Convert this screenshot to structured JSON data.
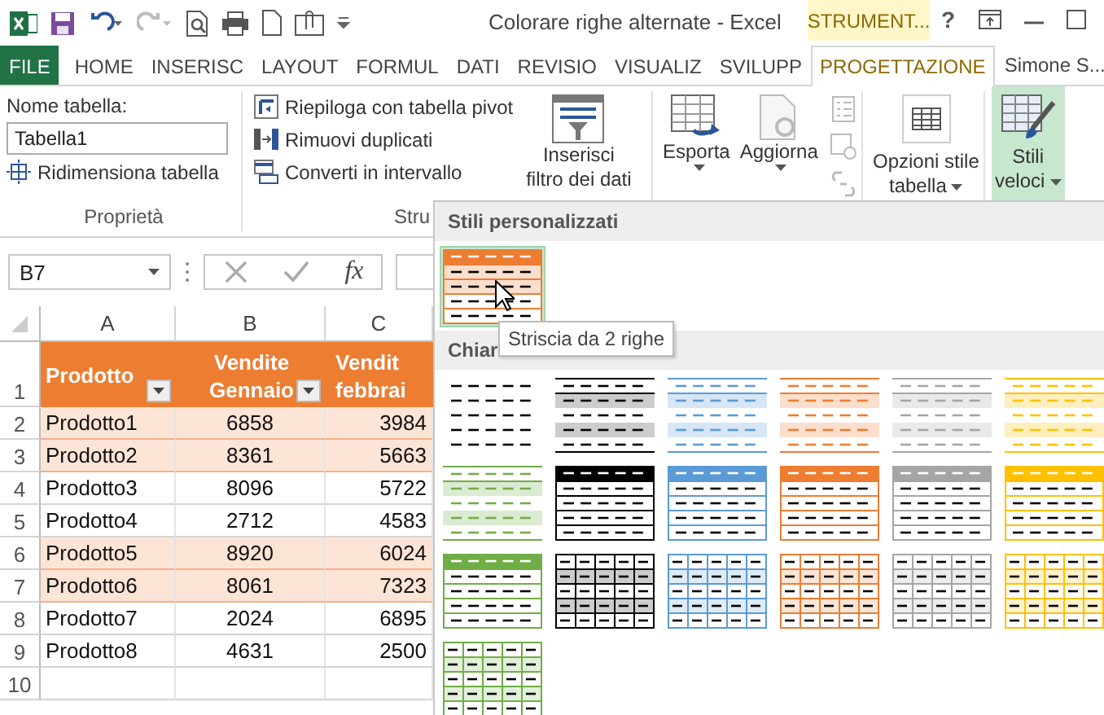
{
  "title_bar": {
    "title": "Colorare righe alternate - Excel",
    "context_label": "STRUMENT...",
    "help": "?"
  },
  "ribbon_tabs": [
    {
      "label": "FILE",
      "kind": "file",
      "selected": false
    },
    {
      "label": "HOME",
      "kind": "tab",
      "selected": false
    },
    {
      "label": "INSERISC",
      "kind": "tab",
      "selected": false
    },
    {
      "label": "LAYOUT",
      "kind": "tab",
      "selected": false
    },
    {
      "label": "FORMUL",
      "kind": "tab",
      "selected": false
    },
    {
      "label": "DATI",
      "kind": "tab",
      "selected": false
    },
    {
      "label": "REVISIO",
      "kind": "tab",
      "selected": false
    },
    {
      "label": "VISUALIZ",
      "kind": "tab",
      "selected": false
    },
    {
      "label": "SVILUPP",
      "kind": "tab",
      "selected": false
    },
    {
      "label": "PROGETTAZIONE",
      "kind": "context",
      "selected": true
    }
  ],
  "account": {
    "name": "Simone S..."
  },
  "ribbon": {
    "properties": {
      "name_label": "Nome tabella:",
      "name_value": "Tabella1",
      "resize": "Ridimensiona tabella",
      "group_label": "Proprietà"
    },
    "tools": {
      "commands": [
        "Riepiloga con tabella pivot",
        "Rimuovi duplicati",
        "Converti in intervallo"
      ],
      "slicer": [
        "Inserisci",
        "filtro dei dati"
      ],
      "group_label": "Stru"
    },
    "external": {
      "export": "Esporta",
      "refresh": "Aggiorna"
    },
    "style_options": {
      "lines": [
        "Opzioni stile",
        "tabella"
      ]
    },
    "quick_styles": {
      "lines": [
        "Stili",
        "veloci"
      ],
      "pressed": true
    }
  },
  "formula_bar": {
    "name_box": "B7",
    "function_label": "fx"
  },
  "sheet": {
    "columns": [
      "A",
      "B",
      "C"
    ],
    "header_row": {
      "number": "1",
      "cells": [
        {
          "lines": [
            "Prodotto"
          ],
          "filter": true
        },
        {
          "lines": [
            "Vendite",
            "Gennaio"
          ],
          "filter": true
        },
        {
          "lines": [
            "Vendit",
            "febbrai"
          ],
          "filter": false
        }
      ]
    },
    "rows": [
      {
        "number": "2",
        "banded": true,
        "cells": [
          "Prodotto1",
          "6858",
          "3984"
        ]
      },
      {
        "number": "3",
        "banded": true,
        "cells": [
          "Prodotto2",
          "8361",
          "5663"
        ]
      },
      {
        "number": "4",
        "banded": false,
        "cells": [
          "Prodotto3",
          "8096",
          "5722"
        ]
      },
      {
        "number": "5",
        "banded": false,
        "cells": [
          "Prodotto4",
          "2712",
          "4583"
        ]
      },
      {
        "number": "6",
        "banded": true,
        "cells": [
          "Prodotto5",
          "8920",
          "6024"
        ]
      },
      {
        "number": "7",
        "banded": true,
        "cells": [
          "Prodotto6",
          "8061",
          "7323"
        ]
      },
      {
        "number": "8",
        "banded": false,
        "cells": [
          "Prodotto7",
          "2024",
          "6895"
        ]
      },
      {
        "number": "9",
        "banded": false,
        "cells": [
          "Prodotto8",
          "4631",
          "2500"
        ]
      },
      {
        "number": "10",
        "banded": false,
        "cells": []
      }
    ]
  },
  "styles_gallery": {
    "sections": [
      {
        "title": "Stili personalizzati",
        "styles": [
          {
            "kind": "striped2",
            "color": "#ed7d31",
            "selected": true
          }
        ]
      },
      {
        "title": "Chiar",
        "styles": [
          {
            "kind": "plain",
            "color": "#000000",
            "selected": false
          },
          {
            "kind": "light",
            "color": "#000000",
            "selected": false
          },
          {
            "kind": "light",
            "color": "#5b9bd5",
            "selected": false
          },
          {
            "kind": "light",
            "color": "#ed7d31",
            "selected": false
          },
          {
            "kind": "light",
            "color": "#a5a5a5",
            "selected": false
          },
          {
            "kind": "light",
            "color": "#ffc000",
            "selected": false
          },
          {
            "kind": "light",
            "color": "#70ad47",
            "selected": false
          },
          {
            "kind": "medium",
            "color": "#000000",
            "selected": false
          },
          {
            "kind": "medium",
            "color": "#5b9bd5",
            "selected": false
          },
          {
            "kind": "medium",
            "color": "#ed7d31",
            "selected": false
          },
          {
            "kind": "medium",
            "color": "#a5a5a5",
            "selected": false
          },
          {
            "kind": "medium",
            "color": "#ffc000",
            "selected": false
          },
          {
            "kind": "medium",
            "color": "#70ad47",
            "selected": false
          },
          {
            "kind": "grid",
            "color": "#000000",
            "selected": false
          },
          {
            "kind": "grid",
            "color": "#5b9bd5",
            "selected": false
          },
          {
            "kind": "grid",
            "color": "#ed7d31",
            "selected": false
          },
          {
            "kind": "grid",
            "color": "#a5a5a5",
            "selected": false
          },
          {
            "kind": "grid",
            "color": "#ffc000",
            "selected": false
          },
          {
            "kind": "grid",
            "color": "#70ad47",
            "selected": false
          }
        ]
      }
    ],
    "tooltip": "Striscia da 2 righe"
  }
}
